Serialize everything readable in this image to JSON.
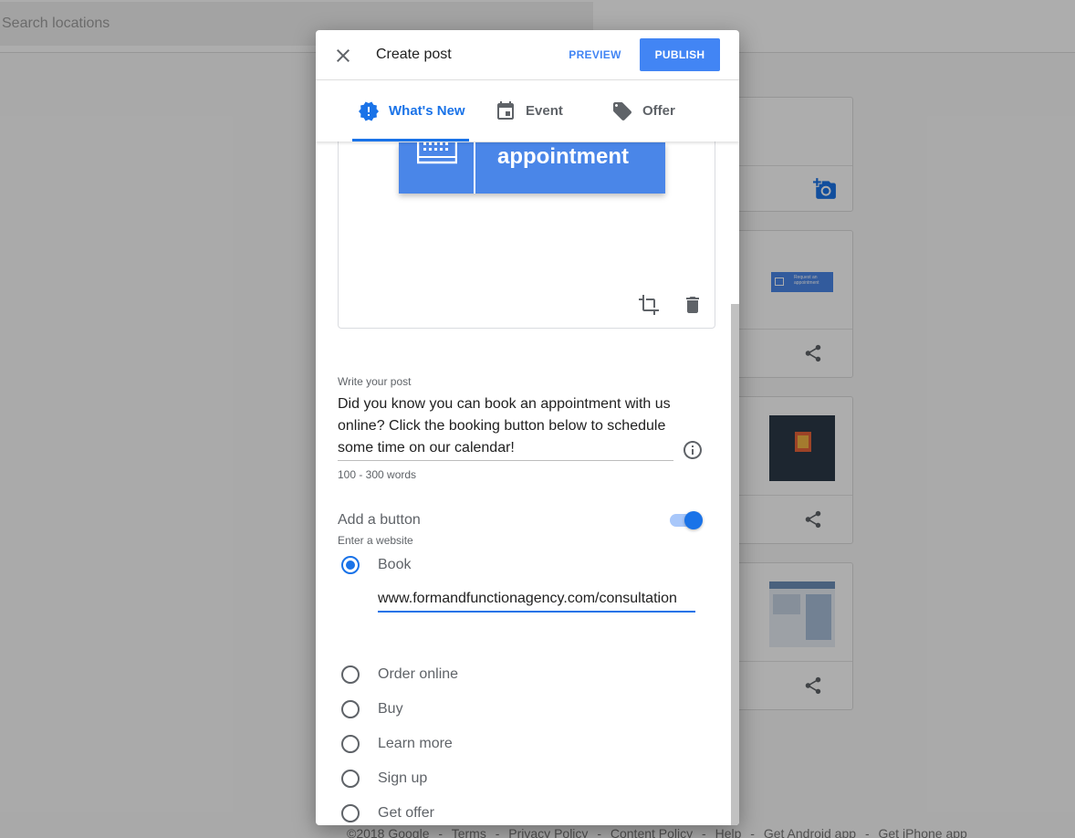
{
  "background": {
    "search_placeholder": "Search locations",
    "card2_thumb_text": [
      "Request an",
      "appointment"
    ],
    "footer_links": [
      "©2018 Google",
      "-",
      "Terms",
      "-",
      "Privacy Policy",
      "-",
      "Content Policy",
      "-",
      "Help",
      "-",
      "Get Android app",
      "-",
      "Get iPhone app"
    ]
  },
  "dialog": {
    "title": "Create post",
    "preview_label": "PREVIEW",
    "publish_label": "PUBLISH",
    "tabs": [
      {
        "label": "What's New",
        "icon": "alert-badge-icon",
        "active": true
      },
      {
        "label": "Event",
        "icon": "calendar-icon",
        "active": false
      },
      {
        "label": "Offer",
        "icon": "tag-icon",
        "active": false
      }
    ],
    "image_text": "appointment",
    "post_label": "Write your post",
    "post_text": "Did you know you can book an appointment with us online? Click the booking button below to schedule some time on our calendar!",
    "post_hint": "100 - 300 words",
    "add_button_label": "Add a button",
    "add_button_enabled": true,
    "website_label": "Enter a website",
    "button_options": [
      {
        "label": "Book",
        "checked": true
      },
      {
        "label": "Order online",
        "checked": false
      },
      {
        "label": "Buy",
        "checked": false
      },
      {
        "label": "Learn more",
        "checked": false
      },
      {
        "label": "Sign up",
        "checked": false
      },
      {
        "label": "Get offer",
        "checked": false
      }
    ],
    "book_url": "www.formandfunctionagency.com/consultation"
  },
  "colors": {
    "accent": "#1a73e8",
    "publish_bg": "#4285f4",
    "image_blue": "#4a86e8"
  }
}
